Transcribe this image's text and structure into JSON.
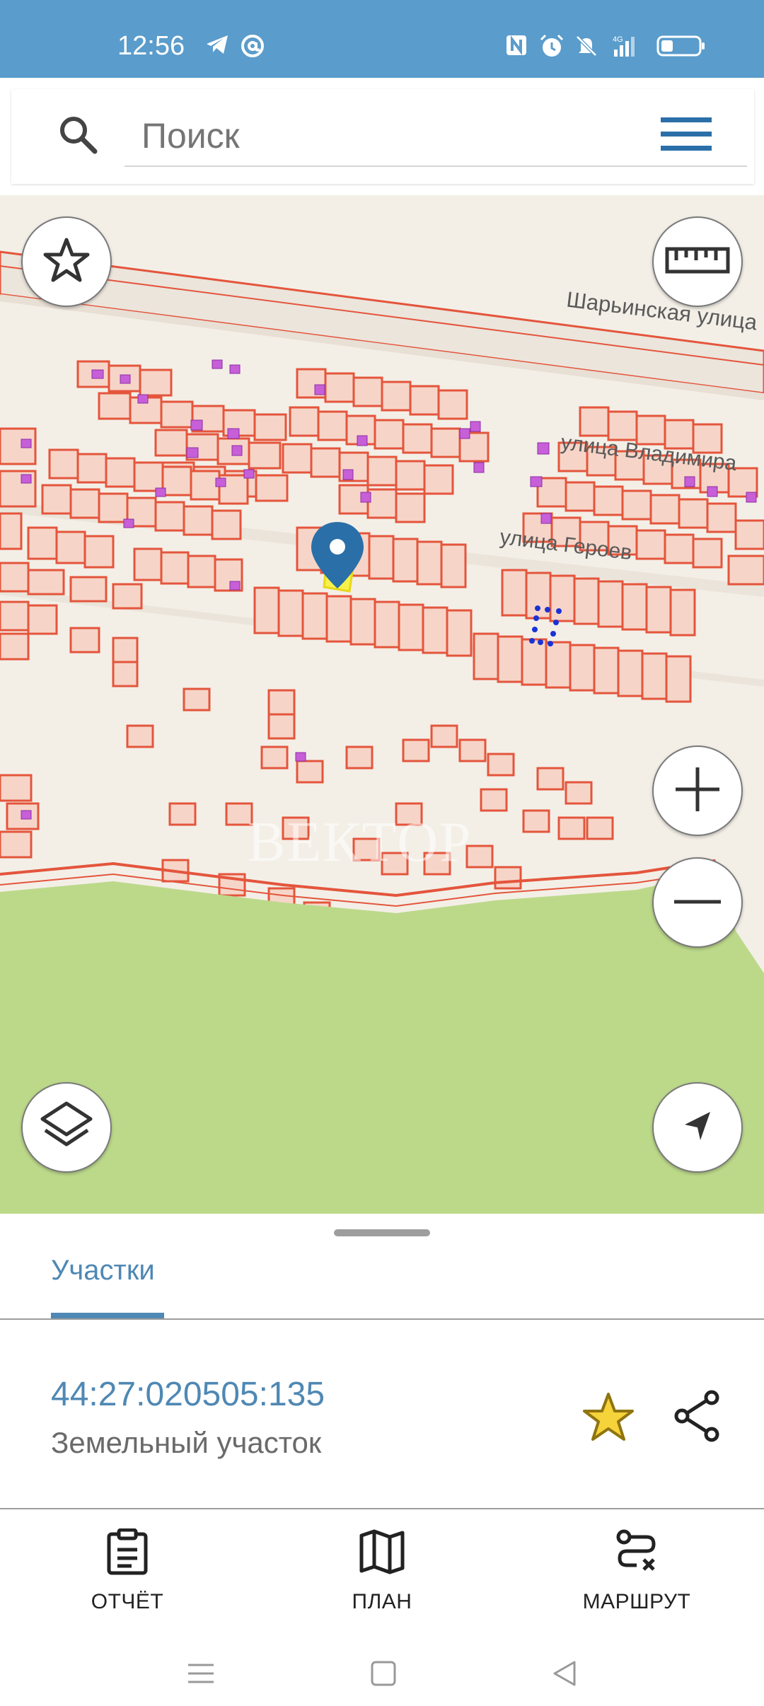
{
  "status_bar": {
    "time": "12:56",
    "left_icons": [
      "telegram-icon",
      "at-sign-icon"
    ],
    "right_icons": [
      "nfc-icon",
      "alarm-icon",
      "mute-icon",
      "signal-4g-icon",
      "battery-icon"
    ],
    "bg_color": "#5a9ccb"
  },
  "search": {
    "placeholder": "Поиск"
  },
  "map": {
    "streets": [
      "Шарьинская улица",
      "улица Владимира",
      "улица Героев"
    ],
    "watermark": "ВЕКТОР",
    "parcel_color": "#e4553c",
    "forest_color": "#bcd98a"
  },
  "sheet": {
    "tab_label": "Участки",
    "parcel": {
      "cadastral_number": "44:27:020505:135",
      "type": "Земельный участок"
    },
    "actions": [
      {
        "label": "ОТЧЁТ",
        "icon": "clipboard-icon"
      },
      {
        "label": "ПЛАН",
        "icon": "map-icon"
      },
      {
        "label": "МАРШРУТ",
        "icon": "route-icon"
      }
    ]
  },
  "colors": {
    "accent": "#4f88b4",
    "star_fill": "#f5d33a"
  }
}
